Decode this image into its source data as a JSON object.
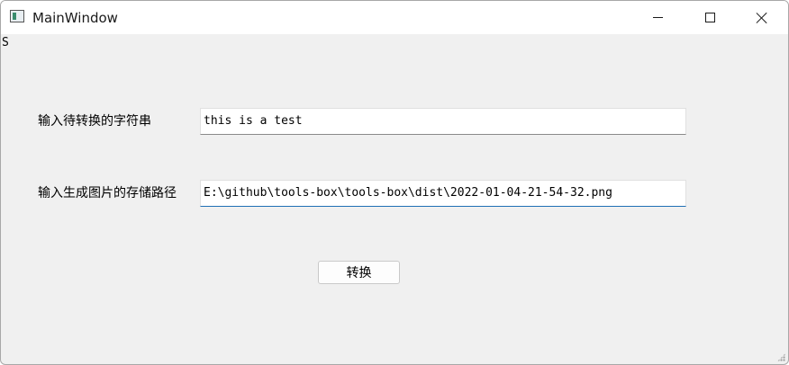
{
  "window": {
    "title": "MainWindow"
  },
  "titlebar": {
    "app_icon": "app-window-icon",
    "minimize_icon": "minimize-icon",
    "maximize_icon": "maximize-icon",
    "close_icon": "close-icon"
  },
  "stray_text": "S",
  "form": {
    "string_label": "输入待转换的字符串",
    "string_value": "this is a test",
    "path_label": "输入生成图片的存储路径",
    "path_value": "E:\\github\\tools-box\\tools-box\\dist\\2022-01-04-21-54-32.png",
    "convert_label": "转换"
  },
  "colors": {
    "window_bg": "#f0f0f0",
    "titlebar_bg": "#ffffff",
    "focus_accent": "#1f6fb5"
  }
}
